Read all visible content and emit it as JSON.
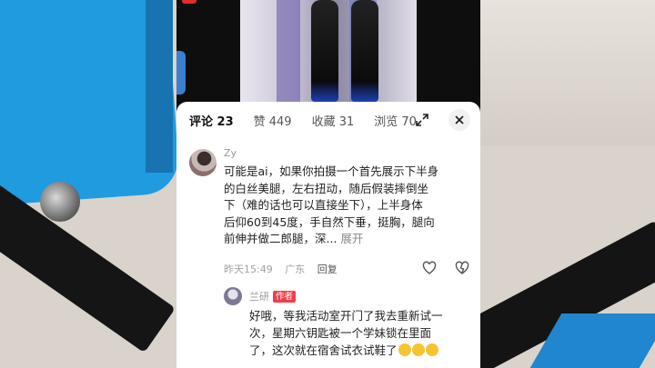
{
  "tabs": [
    {
      "label": "评论 23",
      "active": true
    },
    {
      "label": "赞 449",
      "active": false
    },
    {
      "label": "收藏 31",
      "active": false
    },
    {
      "label": "浏览 70",
      "active": false
    }
  ],
  "comment": {
    "username": "Zy",
    "lines": [
      "可能是ai，如果你拍摄一个首先展示下半身",
      "的白丝美腿，左右扭动，随后假装摔倒坐",
      "下（难的话也可以直接坐下），上半身体",
      "后仰60到45度，手自然下垂，挺胸，腿向"
    ],
    "last_line": "前伸并做二郎腿，深...",
    "more_label": "展开",
    "time": "昨天15:49",
    "location": "广东",
    "reply_label": "回复"
  },
  "reply": {
    "username": "兰研",
    "badge": "作者",
    "lines": [
      "好哦，等我活动室开门了我去重新试一",
      "次，星期六钥匙被一个学妹锁在里面",
      "了，这次就在宿舍试衣试鞋了"
    ]
  },
  "colors": {
    "accent_red": "#f03e4a",
    "background_blue": "#1f9be0"
  },
  "icons": [
    "expand-icon",
    "close-icon",
    "like-icon",
    "dislike-icon"
  ]
}
